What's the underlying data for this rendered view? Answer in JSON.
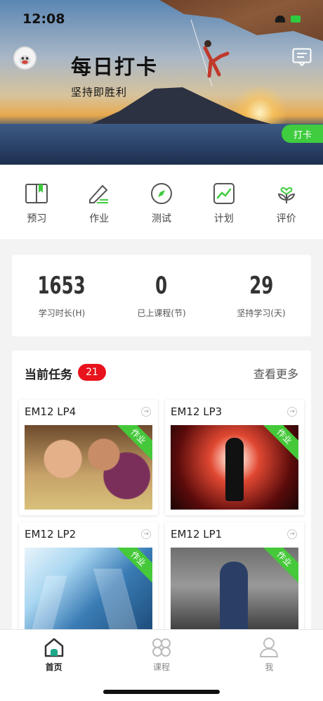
{
  "status_bar": {
    "time": "12:08"
  },
  "header": {
    "title": "每日打卡",
    "subtitle": "坚持即胜利",
    "checkin_label": "打卡"
  },
  "nav": [
    {
      "label": "预习",
      "icon": "book-icon"
    },
    {
      "label": "作业",
      "icon": "pencil-icon"
    },
    {
      "label": "测试",
      "icon": "compass-icon"
    },
    {
      "label": "计划",
      "icon": "chart-icon"
    },
    {
      "label": "评价",
      "icon": "heart-plant-icon"
    }
  ],
  "stats": [
    {
      "value": "1653",
      "caption": "学习时长(H)"
    },
    {
      "value": "0",
      "caption": "已上课程(节)"
    },
    {
      "value": "29",
      "caption": "坚持学习(天)"
    }
  ],
  "tasks": {
    "title": "当前任务",
    "count": "21",
    "more_label": "查看更多",
    "items": [
      {
        "title": "EM12 LP4",
        "tag": "作业"
      },
      {
        "title": "EM12 LP3",
        "tag": "作业"
      },
      {
        "title": "EM12 LP2",
        "tag": "作业"
      },
      {
        "title": "EM12 LP1",
        "tag": "作业"
      }
    ]
  },
  "tabbar": [
    {
      "label": "首页",
      "active": true
    },
    {
      "label": "课程",
      "active": false
    },
    {
      "label": "我",
      "active": false
    }
  ],
  "colors": {
    "accent_green": "#3fcc3f",
    "badge_red": "#e8131c"
  }
}
